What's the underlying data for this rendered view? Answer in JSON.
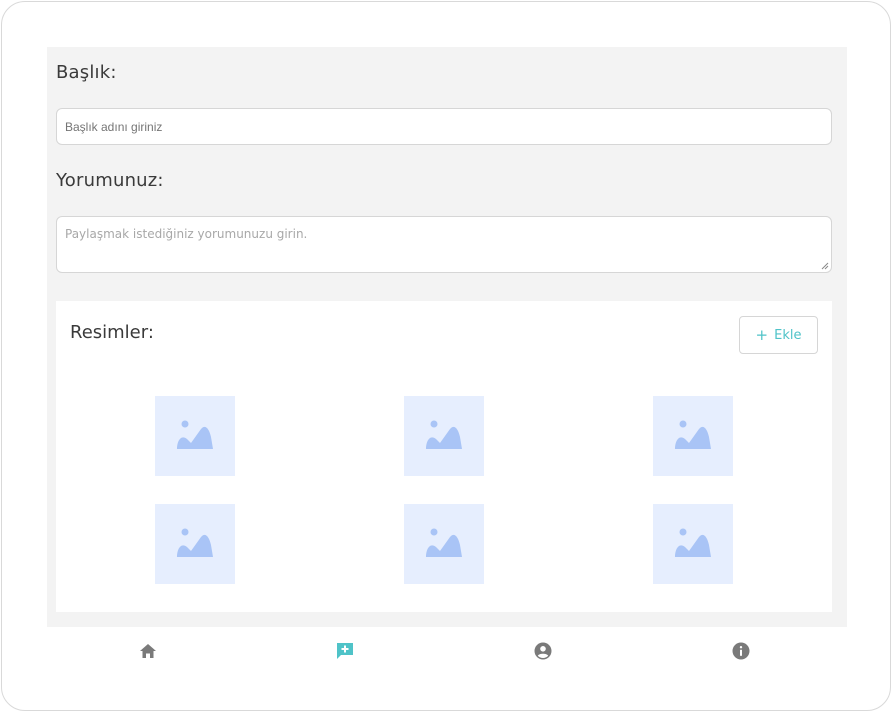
{
  "form": {
    "title_label": "Başlık:",
    "title_placeholder": "Başlık adını giriniz",
    "comment_label": "Yorumunuz:",
    "comment_placeholder": "Paylaşmak istediğiniz yorumunuzu girin."
  },
  "images": {
    "title": "Resimler:",
    "add_label": "Ekle",
    "add_icon": "plus-icon",
    "count": 6,
    "placeholder_icon": "image-placeholder-icon"
  },
  "bottom_nav": {
    "items": [
      {
        "icon": "home-icon",
        "active": false
      },
      {
        "icon": "add-comment-icon",
        "active": true
      },
      {
        "icon": "account-icon",
        "active": false
      },
      {
        "icon": "info-icon",
        "active": false
      }
    ]
  },
  "colors": {
    "accent": "#4fc3c8",
    "icon_inactive": "#7a7a7a",
    "thumb_bg": "#e6eefe",
    "thumb_icon": "#a9c4f6"
  }
}
